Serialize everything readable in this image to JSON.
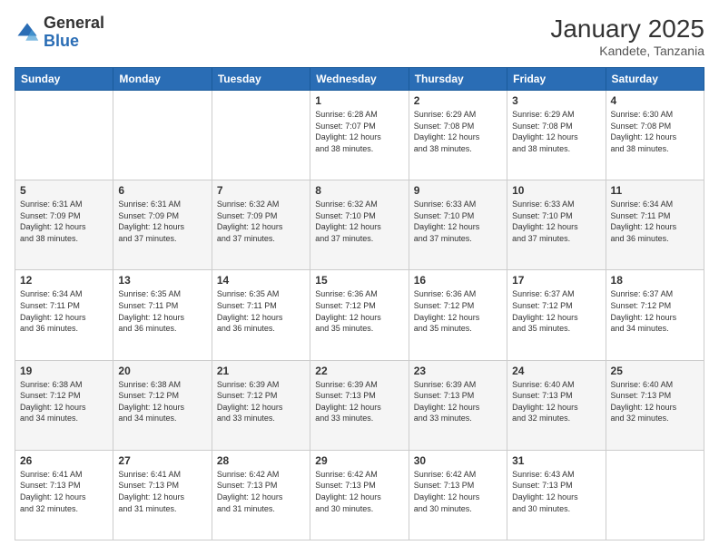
{
  "header": {
    "logo_general": "General",
    "logo_blue": "Blue",
    "month_title": "January 2025",
    "location": "Kandete, Tanzania"
  },
  "days_of_week": [
    "Sunday",
    "Monday",
    "Tuesday",
    "Wednesday",
    "Thursday",
    "Friday",
    "Saturday"
  ],
  "weeks": [
    [
      {
        "day": "",
        "info": ""
      },
      {
        "day": "",
        "info": ""
      },
      {
        "day": "",
        "info": ""
      },
      {
        "day": "1",
        "info": "Sunrise: 6:28 AM\nSunset: 7:07 PM\nDaylight: 12 hours\nand 38 minutes."
      },
      {
        "day": "2",
        "info": "Sunrise: 6:29 AM\nSunset: 7:08 PM\nDaylight: 12 hours\nand 38 minutes."
      },
      {
        "day": "3",
        "info": "Sunrise: 6:29 AM\nSunset: 7:08 PM\nDaylight: 12 hours\nand 38 minutes."
      },
      {
        "day": "4",
        "info": "Sunrise: 6:30 AM\nSunset: 7:08 PM\nDaylight: 12 hours\nand 38 minutes."
      }
    ],
    [
      {
        "day": "5",
        "info": "Sunrise: 6:31 AM\nSunset: 7:09 PM\nDaylight: 12 hours\nand 38 minutes."
      },
      {
        "day": "6",
        "info": "Sunrise: 6:31 AM\nSunset: 7:09 PM\nDaylight: 12 hours\nand 37 minutes."
      },
      {
        "day": "7",
        "info": "Sunrise: 6:32 AM\nSunset: 7:09 PM\nDaylight: 12 hours\nand 37 minutes."
      },
      {
        "day": "8",
        "info": "Sunrise: 6:32 AM\nSunset: 7:10 PM\nDaylight: 12 hours\nand 37 minutes."
      },
      {
        "day": "9",
        "info": "Sunrise: 6:33 AM\nSunset: 7:10 PM\nDaylight: 12 hours\nand 37 minutes."
      },
      {
        "day": "10",
        "info": "Sunrise: 6:33 AM\nSunset: 7:10 PM\nDaylight: 12 hours\nand 37 minutes."
      },
      {
        "day": "11",
        "info": "Sunrise: 6:34 AM\nSunset: 7:11 PM\nDaylight: 12 hours\nand 36 minutes."
      }
    ],
    [
      {
        "day": "12",
        "info": "Sunrise: 6:34 AM\nSunset: 7:11 PM\nDaylight: 12 hours\nand 36 minutes."
      },
      {
        "day": "13",
        "info": "Sunrise: 6:35 AM\nSunset: 7:11 PM\nDaylight: 12 hours\nand 36 minutes."
      },
      {
        "day": "14",
        "info": "Sunrise: 6:35 AM\nSunset: 7:11 PM\nDaylight: 12 hours\nand 36 minutes."
      },
      {
        "day": "15",
        "info": "Sunrise: 6:36 AM\nSunset: 7:12 PM\nDaylight: 12 hours\nand 35 minutes."
      },
      {
        "day": "16",
        "info": "Sunrise: 6:36 AM\nSunset: 7:12 PM\nDaylight: 12 hours\nand 35 minutes."
      },
      {
        "day": "17",
        "info": "Sunrise: 6:37 AM\nSunset: 7:12 PM\nDaylight: 12 hours\nand 35 minutes."
      },
      {
        "day": "18",
        "info": "Sunrise: 6:37 AM\nSunset: 7:12 PM\nDaylight: 12 hours\nand 34 minutes."
      }
    ],
    [
      {
        "day": "19",
        "info": "Sunrise: 6:38 AM\nSunset: 7:12 PM\nDaylight: 12 hours\nand 34 minutes."
      },
      {
        "day": "20",
        "info": "Sunrise: 6:38 AM\nSunset: 7:12 PM\nDaylight: 12 hours\nand 34 minutes."
      },
      {
        "day": "21",
        "info": "Sunrise: 6:39 AM\nSunset: 7:12 PM\nDaylight: 12 hours\nand 33 minutes."
      },
      {
        "day": "22",
        "info": "Sunrise: 6:39 AM\nSunset: 7:13 PM\nDaylight: 12 hours\nand 33 minutes."
      },
      {
        "day": "23",
        "info": "Sunrise: 6:39 AM\nSunset: 7:13 PM\nDaylight: 12 hours\nand 33 minutes."
      },
      {
        "day": "24",
        "info": "Sunrise: 6:40 AM\nSunset: 7:13 PM\nDaylight: 12 hours\nand 32 minutes."
      },
      {
        "day": "25",
        "info": "Sunrise: 6:40 AM\nSunset: 7:13 PM\nDaylight: 12 hours\nand 32 minutes."
      }
    ],
    [
      {
        "day": "26",
        "info": "Sunrise: 6:41 AM\nSunset: 7:13 PM\nDaylight: 12 hours\nand 32 minutes."
      },
      {
        "day": "27",
        "info": "Sunrise: 6:41 AM\nSunset: 7:13 PM\nDaylight: 12 hours\nand 31 minutes."
      },
      {
        "day": "28",
        "info": "Sunrise: 6:42 AM\nSunset: 7:13 PM\nDaylight: 12 hours\nand 31 minutes."
      },
      {
        "day": "29",
        "info": "Sunrise: 6:42 AM\nSunset: 7:13 PM\nDaylight: 12 hours\nand 30 minutes."
      },
      {
        "day": "30",
        "info": "Sunrise: 6:42 AM\nSunset: 7:13 PM\nDaylight: 12 hours\nand 30 minutes."
      },
      {
        "day": "31",
        "info": "Sunrise: 6:43 AM\nSunset: 7:13 PM\nDaylight: 12 hours\nand 30 minutes."
      },
      {
        "day": "",
        "info": ""
      }
    ]
  ]
}
